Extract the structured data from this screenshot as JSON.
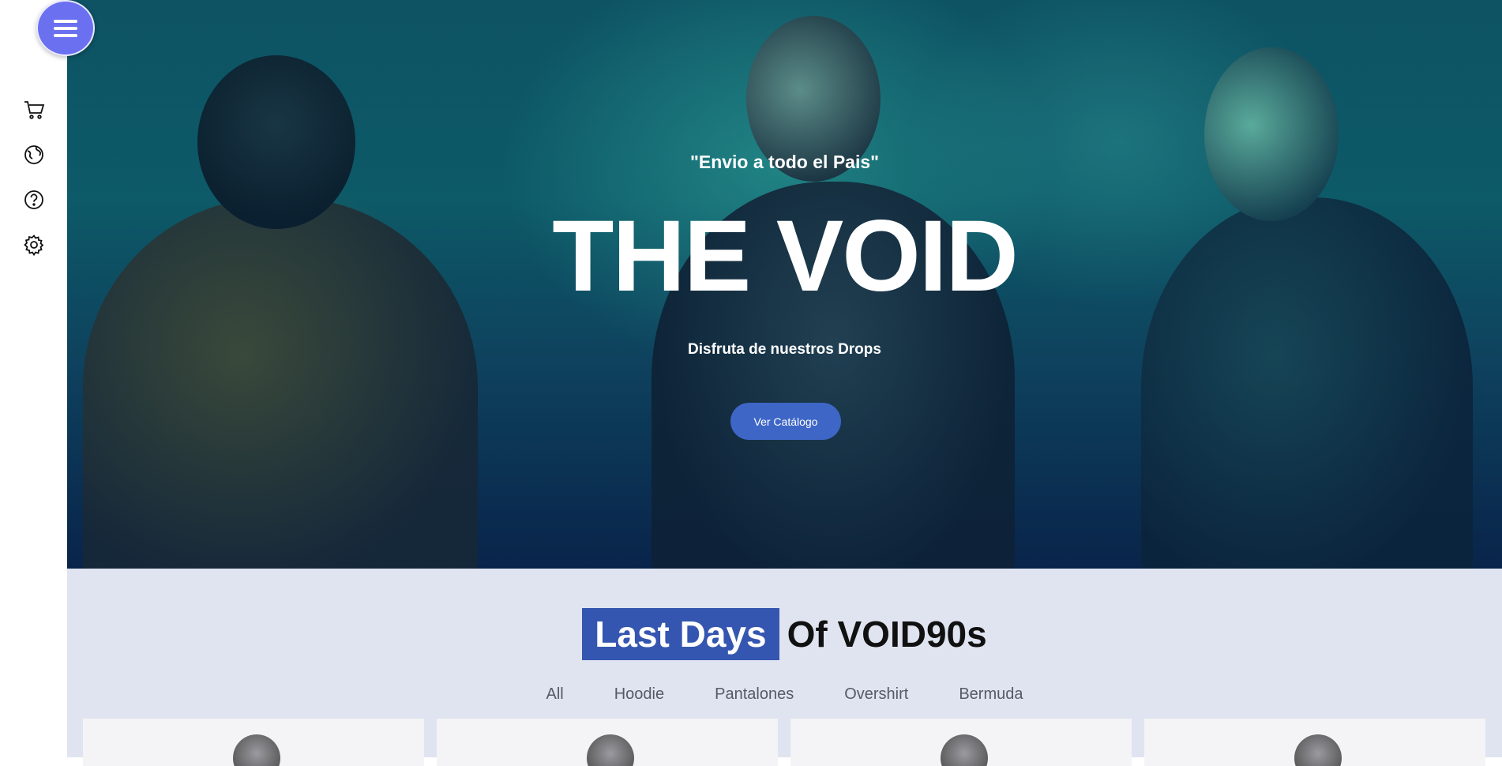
{
  "sidebar": {
    "menu_icon": "hamburger-menu-icon",
    "icons": [
      "cart-icon",
      "globe-icon",
      "help-icon",
      "settings-icon"
    ],
    "menu_color": "#6b70f0"
  },
  "hero": {
    "tagline": "\"Envio a todo el Pais\"",
    "title": "THE VOID",
    "subtitle": "Disfruta de nuestros Drops",
    "cta_label": "Ver Catálogo",
    "cta_color": "#3e66c6"
  },
  "products": {
    "title_highlight": "Last Days",
    "title_rest": "Of VOID90s",
    "highlight_color": "#3556b0",
    "filters": [
      "All",
      "Hoodie",
      "Pantalones",
      "Overshirt",
      "Bermuda"
    ]
  }
}
